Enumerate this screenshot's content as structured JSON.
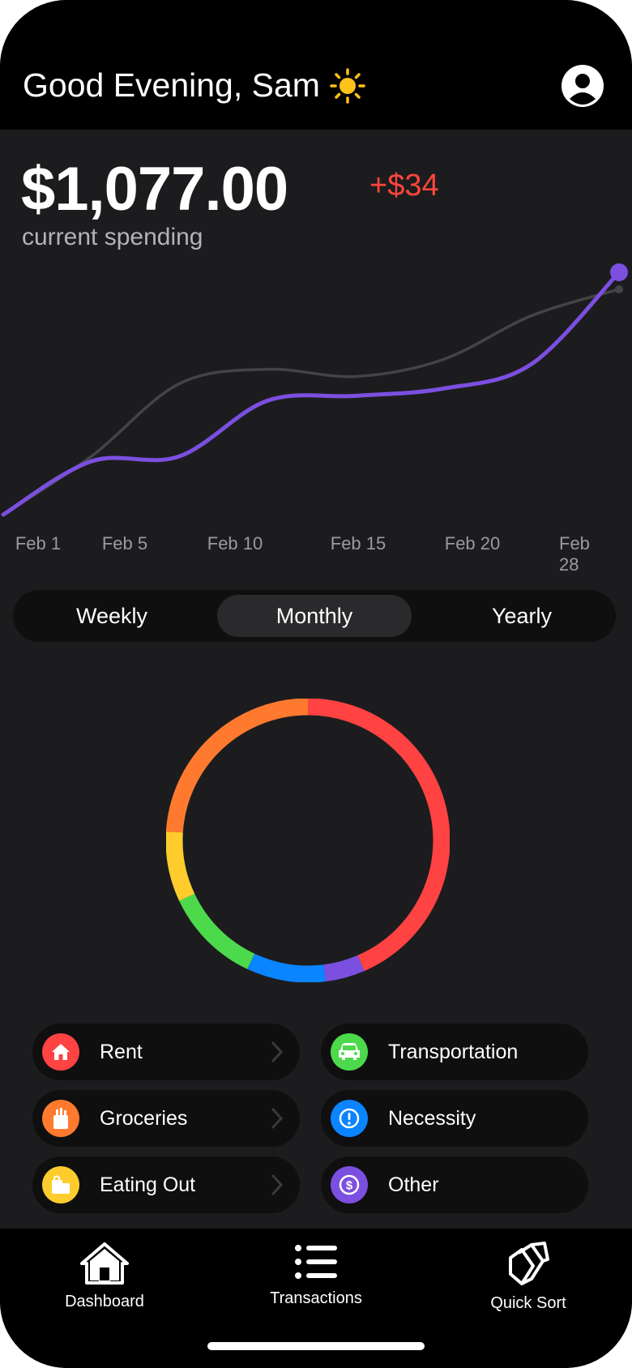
{
  "header": {
    "greeting": "Good Evening, Sam",
    "greeting_icon": "sun-icon",
    "profile_icon": "person-circle-icon"
  },
  "summary": {
    "amount": "$1,077.00",
    "delta": "+$34",
    "caption": "current spending"
  },
  "colors": {
    "accent_purple": "#7b4fe0",
    "delta_red": "#ff453a",
    "rent": "#ff4242",
    "groceries": "#ff7a2e",
    "eating_out": "#ffcc2e",
    "transportation": "#4cd94c",
    "necessity": "#0a84ff",
    "other": "#7b4fe0"
  },
  "chart_data": {
    "type": "line",
    "x_ticks": [
      "Feb 1",
      "Feb 5",
      "Feb 10",
      "Feb 15",
      "Feb 20",
      "Feb 28"
    ],
    "series": [
      {
        "color": "#7b4fe0",
        "values": [
          0.0,
          0.22,
          0.24,
          0.47,
          0.49,
          0.52,
          0.62,
          1.0
        ]
      },
      {
        "color": "#444446",
        "values": [
          0.0,
          0.24,
          0.54,
          0.6,
          0.57,
          0.64,
          0.82,
          0.93
        ]
      }
    ],
    "grid": false,
    "legend": "none"
  },
  "period_tabs": {
    "options": [
      "Weekly",
      "Monthly",
      "Yearly"
    ],
    "selected": "Monthly"
  },
  "donut": {
    "type": "pie",
    "segments": [
      {
        "category": "Rent",
        "fraction": 0.435,
        "color": "#ff4242"
      },
      {
        "category": "Other",
        "fraction": 0.045,
        "color": "#7b4fe0"
      },
      {
        "category": "Necessity",
        "fraction": 0.09,
        "color": "#0a84ff"
      },
      {
        "category": "Transportation",
        "fraction": 0.11,
        "color": "#4cd94c"
      },
      {
        "category": "Eating Out",
        "fraction": 0.08,
        "color": "#ffcc2e"
      },
      {
        "category": "Groceries",
        "fraction": 0.24,
        "color": "#ff7a2e"
      }
    ]
  },
  "categories": [
    {
      "label": "Rent",
      "icon": "house-icon",
      "color": "#ff4242",
      "chevron": true
    },
    {
      "label": "Transportation",
      "icon": "car-icon",
      "color": "#4cd94c",
      "chevron": false
    },
    {
      "label": "Groceries",
      "icon": "grocery-bag-icon",
      "color": "#ff7a2e",
      "chevron": true
    },
    {
      "label": "Necessity",
      "icon": "exclamation-icon",
      "color": "#0a84ff",
      "chevron": false
    },
    {
      "label": "Eating Out",
      "icon": "takeout-icon",
      "color": "#ffcc2e",
      "chevron": true
    },
    {
      "label": "Other",
      "icon": "dollar-icon",
      "color": "#7b4fe0",
      "chevron": false
    }
  ],
  "nav": [
    {
      "label": "Dashboard",
      "icon": "home-icon"
    },
    {
      "label": "Transactions",
      "icon": "list-icon"
    },
    {
      "label": "Quick Sort",
      "icon": "stack-icon"
    }
  ]
}
